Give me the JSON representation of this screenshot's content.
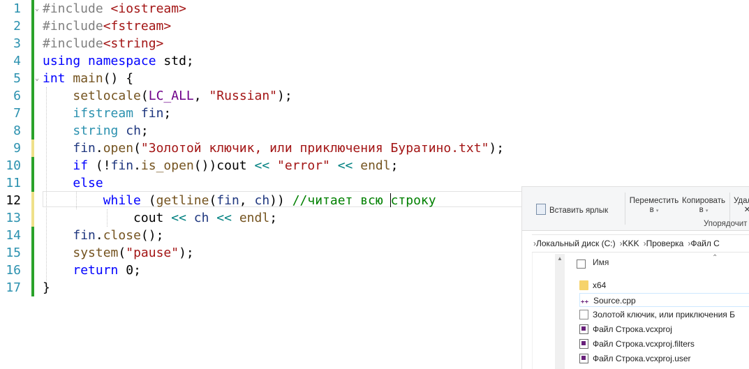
{
  "editor": {
    "current_line": 12,
    "lines": [
      {
        "n": "1",
        "tokens": [
          [
            "pp",
            "#include "
          ],
          [
            "inc",
            "<iostream>"
          ]
        ]
      },
      {
        "n": "2",
        "tokens": [
          [
            "pp",
            "#include"
          ],
          [
            "inc",
            "<fstream>"
          ]
        ]
      },
      {
        "n": "3",
        "tokens": [
          [
            "pp",
            "#include"
          ],
          [
            "inc",
            "<string>"
          ]
        ]
      },
      {
        "n": "4",
        "tokens": [
          [
            "kw",
            "using"
          ],
          [
            "ns",
            " "
          ],
          [
            "kw",
            "namespace"
          ],
          [
            "ns",
            " std;"
          ]
        ]
      },
      {
        "n": "5",
        "tokens": [
          [
            "kw",
            "int"
          ],
          [
            "ns",
            " "
          ],
          [
            "fn",
            "main"
          ],
          [
            "ns",
            "() {"
          ]
        ]
      },
      {
        "n": "6",
        "tokens": [
          [
            "ns",
            "    "
          ],
          [
            "fn",
            "setlocale"
          ],
          [
            "ns",
            "("
          ],
          [
            "mac",
            "LC_ALL"
          ],
          [
            "ns",
            ", "
          ],
          [
            "str",
            "\"Russian\""
          ],
          [
            "ns",
            ");"
          ]
        ]
      },
      {
        "n": "7",
        "tokens": [
          [
            "ns",
            "    "
          ],
          [
            "ty",
            "ifstream"
          ],
          [
            "ns",
            " "
          ],
          [
            "va",
            "fin"
          ],
          [
            "ns",
            ";"
          ]
        ]
      },
      {
        "n": "8",
        "tokens": [
          [
            "ns",
            "    "
          ],
          [
            "ty",
            "string"
          ],
          [
            "ns",
            " "
          ],
          [
            "va",
            "ch"
          ],
          [
            "ns",
            ";"
          ]
        ]
      },
      {
        "n": "9",
        "tokens": [
          [
            "ns",
            "    "
          ],
          [
            "va",
            "fin"
          ],
          [
            "ns",
            "."
          ],
          [
            "fn",
            "open"
          ],
          [
            "ns",
            "("
          ],
          [
            "str",
            "\"Золотой ключик, или приключения Буратино.txt\""
          ],
          [
            "ns",
            ");"
          ]
        ]
      },
      {
        "n": "10",
        "tokens": [
          [
            "ns",
            "    "
          ],
          [
            "kw",
            "if"
          ],
          [
            "ns",
            " (!"
          ],
          [
            "va",
            "fin"
          ],
          [
            "ns",
            "."
          ],
          [
            "fn",
            "is_open"
          ],
          [
            "ns",
            "())cout "
          ],
          [
            "op",
            "<<"
          ],
          [
            "ns",
            " "
          ],
          [
            "str",
            "\"error\""
          ],
          [
            "ns",
            " "
          ],
          [
            "op",
            "<<"
          ],
          [
            "ns",
            " "
          ],
          [
            "fn",
            "endl"
          ],
          [
            "ns",
            ";"
          ]
        ]
      },
      {
        "n": "11",
        "tokens": [
          [
            "ns",
            "    "
          ],
          [
            "kw",
            "else"
          ]
        ]
      },
      {
        "n": "12",
        "tokens": [
          [
            "ns",
            "        "
          ],
          [
            "kw",
            "while"
          ],
          [
            "ns",
            " ("
          ],
          [
            "fn",
            "getline"
          ],
          [
            "ns",
            "("
          ],
          [
            "va",
            "fin"
          ],
          [
            "ns",
            ", "
          ],
          [
            "va",
            "ch"
          ],
          [
            "ns",
            ")) "
          ],
          [
            "cm",
            "//читает всю "
          ],
          [
            "caret",
            ""
          ],
          [
            "cm",
            "строку"
          ]
        ]
      },
      {
        "n": "13",
        "tokens": [
          [
            "ns",
            "            cout "
          ],
          [
            "op",
            "<<"
          ],
          [
            "ns",
            " "
          ],
          [
            "va",
            "ch"
          ],
          [
            "ns",
            " "
          ],
          [
            "op",
            "<<"
          ],
          [
            "ns",
            " "
          ],
          [
            "fn",
            "endl"
          ],
          [
            "ns",
            ";"
          ]
        ]
      },
      {
        "n": "14",
        "tokens": [
          [
            "ns",
            "    "
          ],
          [
            "va",
            "fin"
          ],
          [
            "ns",
            "."
          ],
          [
            "fn",
            "close"
          ],
          [
            "ns",
            "();"
          ]
        ]
      },
      {
        "n": "15",
        "tokens": [
          [
            "ns",
            "    "
          ],
          [
            "fn",
            "system"
          ],
          [
            "ns",
            "("
          ],
          [
            "str",
            "\"pause\""
          ],
          [
            "ns",
            ");"
          ]
        ]
      },
      {
        "n": "16",
        "tokens": [
          [
            "ns",
            "    "
          ],
          [
            "kw",
            "return"
          ],
          [
            "ns",
            " 0;"
          ]
        ]
      },
      {
        "n": "17",
        "tokens": [
          [
            "ns",
            "}"
          ]
        ]
      }
    ]
  },
  "explorer": {
    "ribbon": {
      "paste_shortcut": "Вставить ярлык",
      "move_to": "Переместить",
      "move_to_sub": "в",
      "copy_to": "Копировать",
      "copy_to_sub": "в",
      "delete": "Удал",
      "organize_group": "Упорядочит"
    },
    "breadcrumb": [
      "Локальный диск (C:)",
      "KKK",
      "Проверка",
      "Файл С"
    ],
    "column_name": "Имя",
    "files": [
      {
        "name": "x64",
        "icon": "folder-icon"
      },
      {
        "name": "Source.cpp",
        "icon": "cpp-file-icon"
      },
      {
        "name": "Золотой ключик, или приключения Б",
        "icon": "text-file-icon"
      },
      {
        "name": "Файл Строка.vcxproj",
        "icon": "vcxproj-icon"
      },
      {
        "name": "Файл Строка.vcxproj.filters",
        "icon": "filters-file-icon"
      },
      {
        "name": "Файл Строка.vcxproj.user",
        "icon": "user-file-icon"
      }
    ]
  }
}
